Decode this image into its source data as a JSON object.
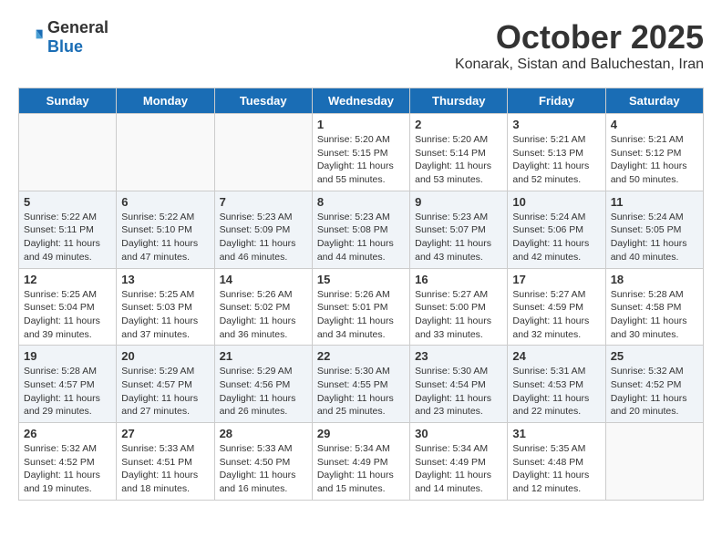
{
  "logo": {
    "text_general": "General",
    "text_blue": "Blue"
  },
  "title": {
    "month": "October 2025",
    "location": "Konarak, Sistan and Baluchestan, Iran"
  },
  "weekdays": [
    "Sunday",
    "Monday",
    "Tuesday",
    "Wednesday",
    "Thursday",
    "Friday",
    "Saturday"
  ],
  "weeks": [
    [
      {
        "day": "",
        "sunrise": "",
        "sunset": "",
        "daylight": ""
      },
      {
        "day": "",
        "sunrise": "",
        "sunset": "",
        "daylight": ""
      },
      {
        "day": "",
        "sunrise": "",
        "sunset": "",
        "daylight": ""
      },
      {
        "day": "1",
        "sunrise": "Sunrise: 5:20 AM",
        "sunset": "Sunset: 5:15 PM",
        "daylight": "Daylight: 11 hours and 55 minutes."
      },
      {
        "day": "2",
        "sunrise": "Sunrise: 5:20 AM",
        "sunset": "Sunset: 5:14 PM",
        "daylight": "Daylight: 11 hours and 53 minutes."
      },
      {
        "day": "3",
        "sunrise": "Sunrise: 5:21 AM",
        "sunset": "Sunset: 5:13 PM",
        "daylight": "Daylight: 11 hours and 52 minutes."
      },
      {
        "day": "4",
        "sunrise": "Sunrise: 5:21 AM",
        "sunset": "Sunset: 5:12 PM",
        "daylight": "Daylight: 11 hours and 50 minutes."
      }
    ],
    [
      {
        "day": "5",
        "sunrise": "Sunrise: 5:22 AM",
        "sunset": "Sunset: 5:11 PM",
        "daylight": "Daylight: 11 hours and 49 minutes."
      },
      {
        "day": "6",
        "sunrise": "Sunrise: 5:22 AM",
        "sunset": "Sunset: 5:10 PM",
        "daylight": "Daylight: 11 hours and 47 minutes."
      },
      {
        "day": "7",
        "sunrise": "Sunrise: 5:23 AM",
        "sunset": "Sunset: 5:09 PM",
        "daylight": "Daylight: 11 hours and 46 minutes."
      },
      {
        "day": "8",
        "sunrise": "Sunrise: 5:23 AM",
        "sunset": "Sunset: 5:08 PM",
        "daylight": "Daylight: 11 hours and 44 minutes."
      },
      {
        "day": "9",
        "sunrise": "Sunrise: 5:23 AM",
        "sunset": "Sunset: 5:07 PM",
        "daylight": "Daylight: 11 hours and 43 minutes."
      },
      {
        "day": "10",
        "sunrise": "Sunrise: 5:24 AM",
        "sunset": "Sunset: 5:06 PM",
        "daylight": "Daylight: 11 hours and 42 minutes."
      },
      {
        "day": "11",
        "sunrise": "Sunrise: 5:24 AM",
        "sunset": "Sunset: 5:05 PM",
        "daylight": "Daylight: 11 hours and 40 minutes."
      }
    ],
    [
      {
        "day": "12",
        "sunrise": "Sunrise: 5:25 AM",
        "sunset": "Sunset: 5:04 PM",
        "daylight": "Daylight: 11 hours and 39 minutes."
      },
      {
        "day": "13",
        "sunrise": "Sunrise: 5:25 AM",
        "sunset": "Sunset: 5:03 PM",
        "daylight": "Daylight: 11 hours and 37 minutes."
      },
      {
        "day": "14",
        "sunrise": "Sunrise: 5:26 AM",
        "sunset": "Sunset: 5:02 PM",
        "daylight": "Daylight: 11 hours and 36 minutes."
      },
      {
        "day": "15",
        "sunrise": "Sunrise: 5:26 AM",
        "sunset": "Sunset: 5:01 PM",
        "daylight": "Daylight: 11 hours and 34 minutes."
      },
      {
        "day": "16",
        "sunrise": "Sunrise: 5:27 AM",
        "sunset": "Sunset: 5:00 PM",
        "daylight": "Daylight: 11 hours and 33 minutes."
      },
      {
        "day": "17",
        "sunrise": "Sunrise: 5:27 AM",
        "sunset": "Sunset: 4:59 PM",
        "daylight": "Daylight: 11 hours and 32 minutes."
      },
      {
        "day": "18",
        "sunrise": "Sunrise: 5:28 AM",
        "sunset": "Sunset: 4:58 PM",
        "daylight": "Daylight: 11 hours and 30 minutes."
      }
    ],
    [
      {
        "day": "19",
        "sunrise": "Sunrise: 5:28 AM",
        "sunset": "Sunset: 4:57 PM",
        "daylight": "Daylight: 11 hours and 29 minutes."
      },
      {
        "day": "20",
        "sunrise": "Sunrise: 5:29 AM",
        "sunset": "Sunset: 4:57 PM",
        "daylight": "Daylight: 11 hours and 27 minutes."
      },
      {
        "day": "21",
        "sunrise": "Sunrise: 5:29 AM",
        "sunset": "Sunset: 4:56 PM",
        "daylight": "Daylight: 11 hours and 26 minutes."
      },
      {
        "day": "22",
        "sunrise": "Sunrise: 5:30 AM",
        "sunset": "Sunset: 4:55 PM",
        "daylight": "Daylight: 11 hours and 25 minutes."
      },
      {
        "day": "23",
        "sunrise": "Sunrise: 5:30 AM",
        "sunset": "Sunset: 4:54 PM",
        "daylight": "Daylight: 11 hours and 23 minutes."
      },
      {
        "day": "24",
        "sunrise": "Sunrise: 5:31 AM",
        "sunset": "Sunset: 4:53 PM",
        "daylight": "Daylight: 11 hours and 22 minutes."
      },
      {
        "day": "25",
        "sunrise": "Sunrise: 5:32 AM",
        "sunset": "Sunset: 4:52 PM",
        "daylight": "Daylight: 11 hours and 20 minutes."
      }
    ],
    [
      {
        "day": "26",
        "sunrise": "Sunrise: 5:32 AM",
        "sunset": "Sunset: 4:52 PM",
        "daylight": "Daylight: 11 hours and 19 minutes."
      },
      {
        "day": "27",
        "sunrise": "Sunrise: 5:33 AM",
        "sunset": "Sunset: 4:51 PM",
        "daylight": "Daylight: 11 hours and 18 minutes."
      },
      {
        "day": "28",
        "sunrise": "Sunrise: 5:33 AM",
        "sunset": "Sunset: 4:50 PM",
        "daylight": "Daylight: 11 hours and 16 minutes."
      },
      {
        "day": "29",
        "sunrise": "Sunrise: 5:34 AM",
        "sunset": "Sunset: 4:49 PM",
        "daylight": "Daylight: 11 hours and 15 minutes."
      },
      {
        "day": "30",
        "sunrise": "Sunrise: 5:34 AM",
        "sunset": "Sunset: 4:49 PM",
        "daylight": "Daylight: 11 hours and 14 minutes."
      },
      {
        "day": "31",
        "sunrise": "Sunrise: 5:35 AM",
        "sunset": "Sunset: 4:48 PM",
        "daylight": "Daylight: 11 hours and 12 minutes."
      },
      {
        "day": "",
        "sunrise": "",
        "sunset": "",
        "daylight": ""
      }
    ]
  ]
}
